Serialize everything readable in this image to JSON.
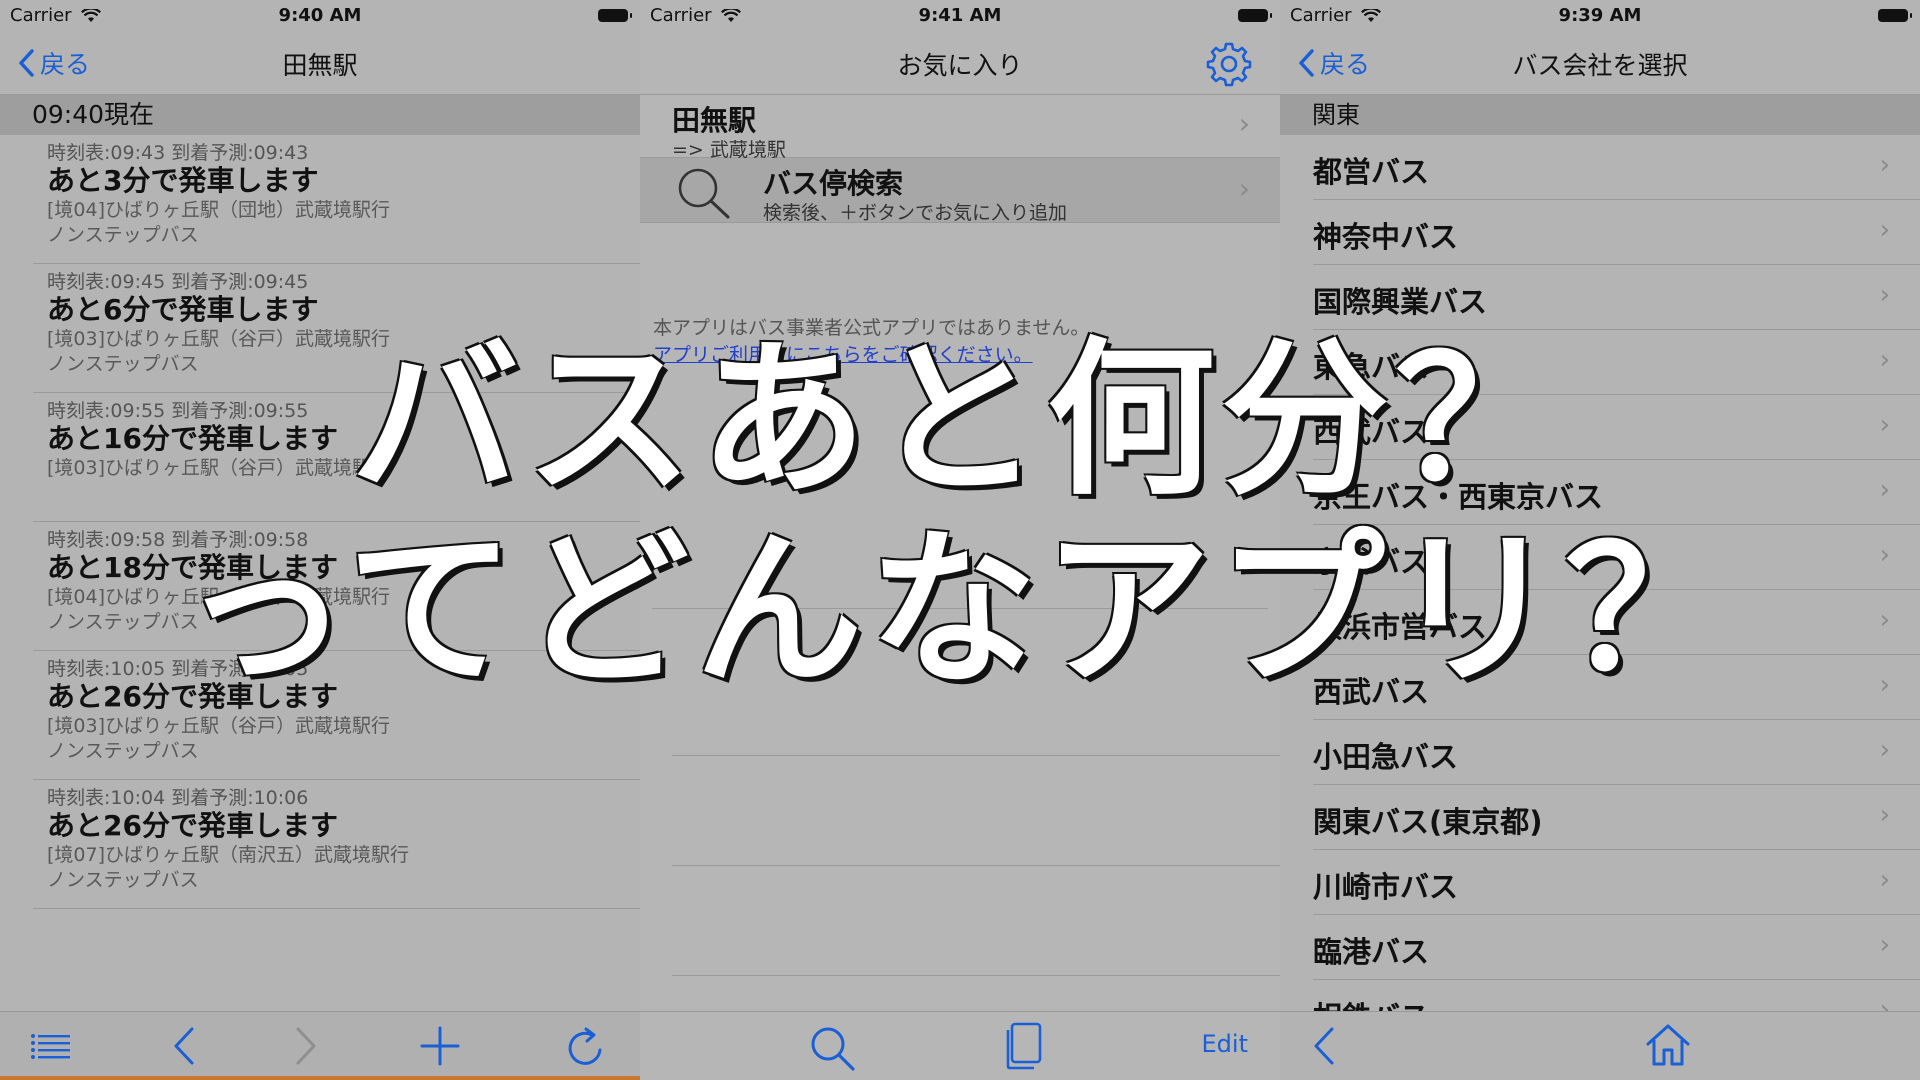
{
  "colors": {
    "ios_blue": "#1a5fd6",
    "link": "#2240c9",
    "accent_orange": "#c9762e"
  },
  "left": {
    "status": {
      "carrier": "Carrier",
      "time": "9:40 AM"
    },
    "nav": {
      "back": "戻る",
      "title": "田無駅"
    },
    "section": "09:40現在",
    "arrivals": [
      {
        "time": "時刻表:09:43 到着予測:09:43",
        "main": "あと3分で発車します",
        "route": "[境04]ひばりヶ丘駅（団地）武蔵境駅行",
        "type": "ノンステップバス"
      },
      {
        "time": "時刻表:09:45 到着予測:09:45",
        "main": "あと6分で発車します",
        "route": "[境03]ひばりヶ丘駅（谷戸）武蔵境駅行",
        "type": "ノンステップバス"
      },
      {
        "time": "時刻表:09:55 到着予測:09:55",
        "main": "あと16分で発車します",
        "route": "[境03]ひばりヶ丘駅（谷戸）武蔵境駅行",
        "type": ""
      },
      {
        "time": "時刻表:09:58 到着予測:09:58",
        "main": "あと18分で発車します",
        "route": "[境04]ひばりヶ丘駅（団地）武蔵境駅行",
        "type": "ノンステップバス"
      },
      {
        "time": "時刻表:10:05 到着予測:10:05",
        "main": "あと26分で発車します",
        "route": "[境03]ひばりヶ丘駅（谷戸）武蔵境駅行",
        "type": "ノンステップバス"
      },
      {
        "time": "時刻表:10:04 到着予測:10:06",
        "main": "あと26分で発車します",
        "route": "[境07]ひばりヶ丘駅（南沢五）武蔵境駅行",
        "type": "ノンステップバス"
      }
    ],
    "toolbar": [
      "list-icon",
      "chevron-left-icon",
      "chevron-right-icon",
      "plus-icon",
      "refresh-icon"
    ]
  },
  "middle": {
    "status": {
      "carrier": "Carrier",
      "time": "9:41 AM"
    },
    "nav": {
      "title": "お気に入り"
    },
    "favorite": {
      "title": "田無駅",
      "sub": "=> 武蔵境駅"
    },
    "search": {
      "title": "バス停検索",
      "sub": "検索後、＋ボタンでお気に入り追加"
    },
    "notice": "本アプリはバス事業者公式アプリではありません。",
    "notice_link": "アプリご利用前にこちらをご確認ください。",
    "edit": "Edit"
  },
  "right": {
    "status": {
      "carrier": "Carrier",
      "time": "9:39 AM"
    },
    "nav": {
      "back": "戻る",
      "title": "バス会社を選択"
    },
    "section": "関東",
    "companies": [
      "都営バス",
      "神奈中バス",
      "国際興業バス",
      "東急バス",
      "西武バス",
      "京王バス・西東京バス",
      "京成バス",
      "横浜市営バス",
      "西武バス",
      "小田急バス",
      "関東バス(東京都)",
      "川崎市バス",
      "臨港バス",
      "相鉄バス"
    ]
  },
  "overlay": {
    "line1": "バスあと何分？",
    "line2": "ってどんなアプリ？"
  }
}
